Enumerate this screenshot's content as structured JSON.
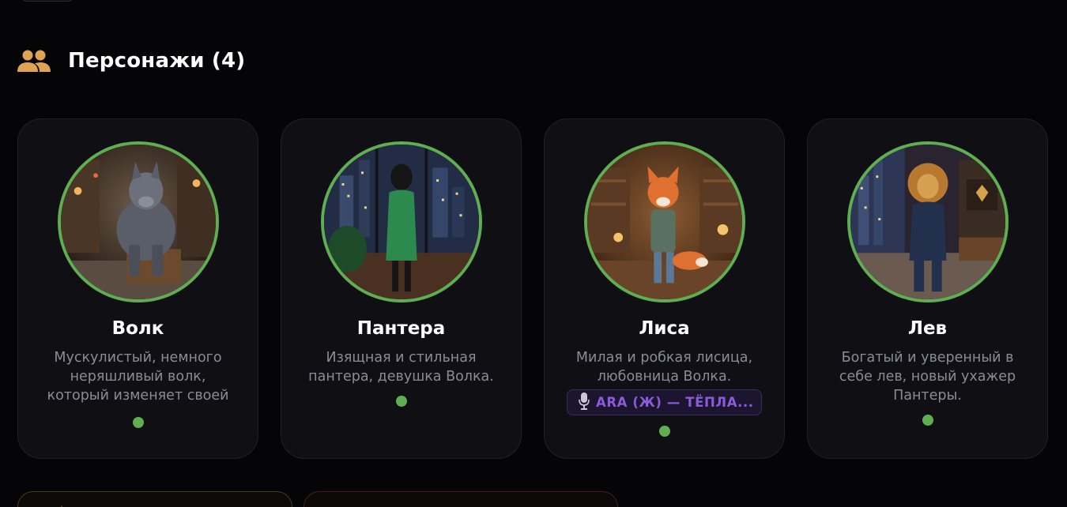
{
  "section": {
    "title": "Персонажи (4)",
    "icon": "people-icon",
    "accent": "#e0a352"
  },
  "characters": [
    {
      "name": "Волк",
      "description": "Мускулистый, немного неряшливый волк, который изменяет своей",
      "status_color": "#5fae52"
    },
    {
      "name": "Пантера",
      "description": "Изящная и стильная пантера, девушка Волка.",
      "status_color": "#5fae52"
    },
    {
      "name": "Лиса",
      "description": "Милая и робкая лисица, любовница Волка.",
      "voice": "ARA (Ж) — ТЁПЛА...",
      "voice_icon": "microphone-icon",
      "status_color": "#5fae52"
    },
    {
      "name": "Лев",
      "description": "Богатый и уверенный в себе лев, новый ухажер Пантеры.",
      "status_color": "#5fae52"
    }
  ]
}
